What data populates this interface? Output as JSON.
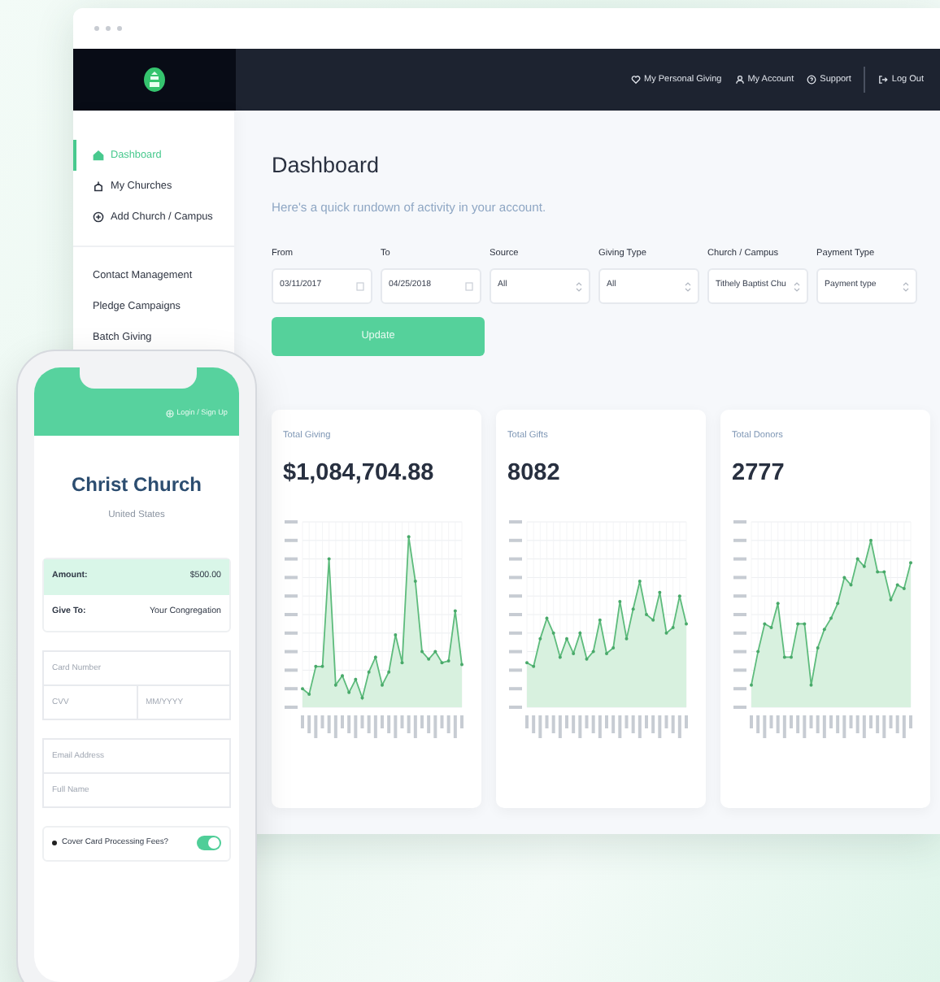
{
  "navbar": {
    "links": [
      {
        "label": "My Personal Giving"
      },
      {
        "label": "My Account"
      },
      {
        "label": "Support"
      }
    ],
    "logout": "Log Out"
  },
  "sidebar": {
    "primary": [
      {
        "label": "Dashboard",
        "selected": true
      },
      {
        "label": "My Churches",
        "selected": false
      },
      {
        "label": "Add Church / Campus",
        "selected": false
      }
    ],
    "secondary": [
      {
        "label": "Contact Management",
        "selected": false
      },
      {
        "label": "Pledge Campaigns",
        "selected": false
      },
      {
        "label": "Batch Giving",
        "selected": false
      }
    ]
  },
  "main": {
    "title": "Dashboard",
    "subtitle": "Here's a quick rundown of activity in your account.",
    "filters": [
      {
        "label": "From",
        "kind": "date",
        "value": "03/11/2017"
      },
      {
        "label": "To",
        "kind": "date",
        "value": "04/25/2018"
      },
      {
        "label": "Source",
        "kind": "select",
        "value": "All"
      },
      {
        "label": "Giving Type",
        "kind": "select",
        "value": "All"
      },
      {
        "label": "Church / Campus",
        "kind": "select",
        "value": "Tithely Baptist Chu"
      },
      {
        "label": "Payment Type",
        "kind": "select",
        "value": "Payment type"
      }
    ],
    "update_button": "Update",
    "stats": [
      {
        "label": "Total Giving",
        "value": "$1,084,704.88"
      },
      {
        "label": "Total Gifts",
        "value": "8082"
      },
      {
        "label": "Total Donors",
        "value": "2777"
      }
    ]
  },
  "phone": {
    "login": "Login / Sign Up",
    "church": "Christ Church",
    "country": "United States",
    "summary": [
      {
        "label": "Amount:",
        "value": "$500.00",
        "highlight": true
      },
      {
        "label": "Give To:",
        "value": "Your Congregation",
        "highlight": false
      }
    ],
    "field_groups": [
      [
        [
          {
            "placeholder": "Card Number"
          }
        ],
        [
          {
            "placeholder": "CVV"
          },
          {
            "placeholder": "MM/YYYY"
          }
        ]
      ],
      [
        [
          {
            "placeholder": "Email Address"
          }
        ],
        [
          {
            "placeholder": "Full Name"
          }
        ]
      ]
    ],
    "cover_fees": {
      "label": "Cover Card Processing Fees?",
      "on": true
    }
  }
}
